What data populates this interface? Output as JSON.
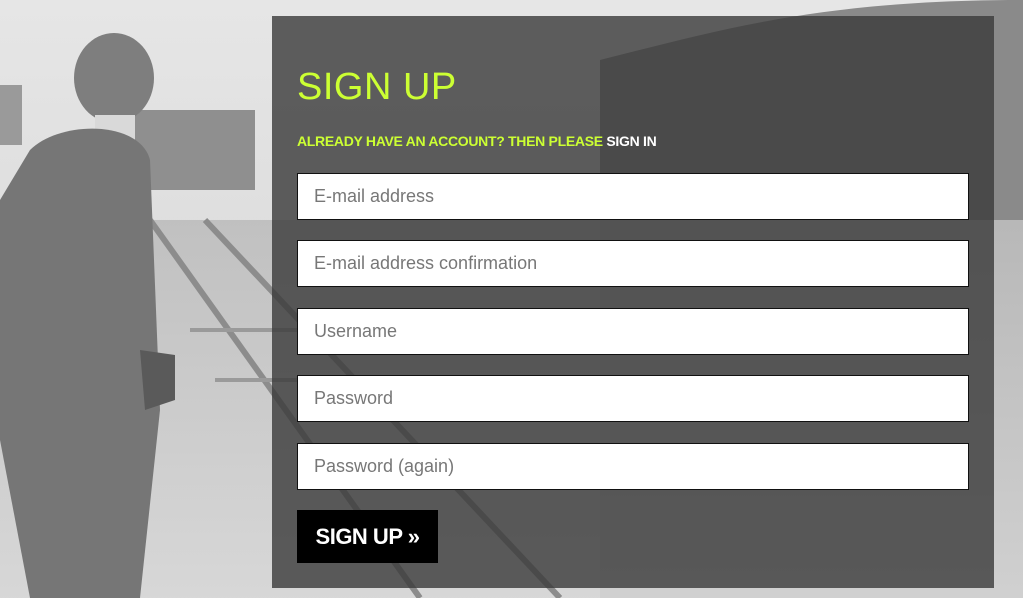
{
  "form": {
    "title": "SIGN UP",
    "signin_prompt": "ALREADY HAVE AN ACCOUNT? THEN PLEASE",
    "signin_link": "SIGN IN",
    "fields": [
      {
        "placeholder": "E-mail address",
        "value": ""
      },
      {
        "placeholder": "E-mail address confirmation",
        "value": ""
      },
      {
        "placeholder": "Username",
        "value": ""
      },
      {
        "placeholder": "Password",
        "value": ""
      },
      {
        "placeholder": "Password (again)",
        "value": ""
      }
    ],
    "submit_label": "SIGN UP »"
  },
  "colors": {
    "accent": "#ccff33",
    "panel": "#3a3a3a",
    "button": "#000000"
  }
}
